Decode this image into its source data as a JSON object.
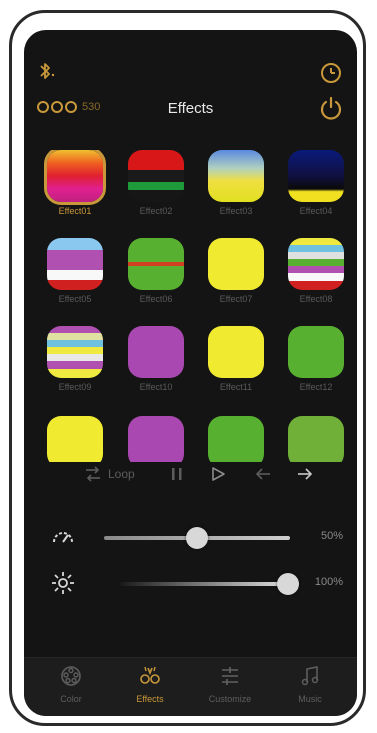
{
  "header": {
    "title": "Effects",
    "brand_suffix": "530"
  },
  "colors": {
    "accent": "#c9983a",
    "background": "#141414",
    "label": "#5a5a5a"
  },
  "effects": [
    {
      "label": "Effect01",
      "selected": true
    },
    {
      "label": "Effect02",
      "selected": false
    },
    {
      "label": "Effect03",
      "selected": false
    },
    {
      "label": "Effect04",
      "selected": false
    },
    {
      "label": "Effect05",
      "selected": false
    },
    {
      "label": "Effect06",
      "selected": false
    },
    {
      "label": "Effect07",
      "selected": false
    },
    {
      "label": "Effect08",
      "selected": false
    },
    {
      "label": "Effect09",
      "selected": false
    },
    {
      "label": "Effect10",
      "selected": false
    },
    {
      "label": "Effect11",
      "selected": false
    },
    {
      "label": "Effect12",
      "selected": false
    }
  ],
  "controls": {
    "loop_label": "Loop"
  },
  "speed": {
    "value_label": "50%",
    "level": 0.5
  },
  "brightness": {
    "value_label": "100%",
    "level": 1.0
  },
  "tabs": [
    {
      "label": "Color",
      "icon": "palette-icon",
      "active": false
    },
    {
      "label": "Effects",
      "icon": "effects-icon",
      "active": true
    },
    {
      "label": "Customize",
      "icon": "customize-icon",
      "active": false
    },
    {
      "label": "Music",
      "icon": "music-icon",
      "active": false
    }
  ]
}
